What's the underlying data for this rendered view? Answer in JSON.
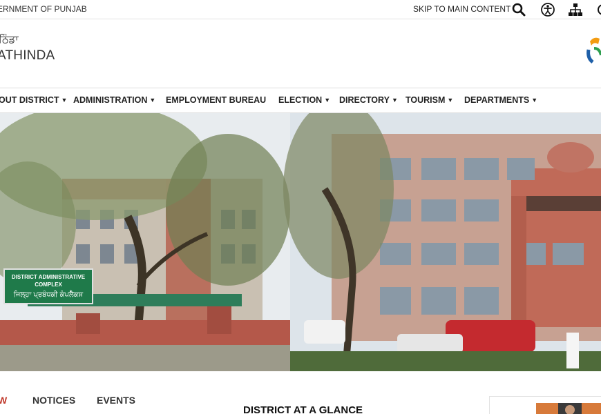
{
  "topbar": {
    "government_label": "ERNMENT OF PUNJAB",
    "skip_link": "SKIP TO MAIN CONTENT",
    "icons": [
      "search-icon",
      "accessibility-icon",
      "sitemap-icon"
    ]
  },
  "branding": {
    "local_script_name": "ਠਿੰਡਾ",
    "district_name": "ATHINDA"
  },
  "nav": {
    "items": [
      {
        "label": "OUT DISTRICT",
        "has_dropdown": true
      },
      {
        "label": "ADMINISTRATION",
        "has_dropdown": true
      },
      {
        "label": "EMPLOYMENT BUREAU",
        "has_dropdown": false
      },
      {
        "label": "ELECTION",
        "has_dropdown": true
      },
      {
        "label": "DIRECTORY",
        "has_dropdown": true
      },
      {
        "label": "TOURISM",
        "has_dropdown": true
      },
      {
        "label": "DEPARTMENTS",
        "has_dropdown": true
      }
    ]
  },
  "banner": {
    "sign_line1": "DISTRICT ADMINISTRATIVE",
    "sign_line2": "COMPLEX",
    "sign_line3": "ਜਿਲ੍ਹਾ ਪ੍ਰਬੰਧਕੀ ਕੰਪਲੈਕਸ"
  },
  "tabs": {
    "items": [
      {
        "label": "W",
        "active": true
      },
      {
        "label": "NOTICES",
        "active": false
      },
      {
        "label": "EVENTS",
        "active": false
      }
    ]
  },
  "main": {
    "glance_title": "DISTRICT AT A GLANCE"
  },
  "colors": {
    "accent": "#c0392b",
    "sign_green": "#1f7a4a",
    "building_brick": "#b06a5a"
  }
}
